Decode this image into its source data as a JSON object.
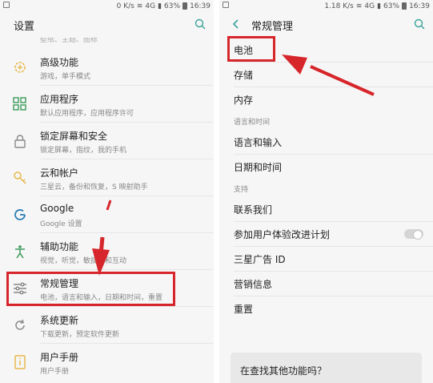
{
  "left": {
    "status": {
      "speed": "0 K/s",
      "signal": "4G",
      "battery": "63%",
      "time": "16:39"
    },
    "title": "设置",
    "cut_text": "壁纸、主题、图标",
    "items": [
      {
        "icon": "gear-plus-icon",
        "label": "高级功能",
        "sub": "游戏，单手模式"
      },
      {
        "icon": "apps-icon",
        "label": "应用程序",
        "sub": "默认应用程序，应用程序许可"
      },
      {
        "icon": "lock-icon",
        "label": "锁定屏幕和安全",
        "sub": "锁定屏幕，指纹，我的手机"
      },
      {
        "icon": "key-icon",
        "label": "云和帐户",
        "sub": "三星云，备份和恢复，S 映射助手"
      },
      {
        "icon": "google-icon",
        "label": "Google",
        "sub": "Google 设置"
      },
      {
        "icon": "accessibility-icon",
        "label": "辅助功能",
        "sub": "视觉，听觉，敏捷度和互动"
      },
      {
        "icon": "sliders-icon",
        "label": "常规管理",
        "sub": "电池，语言和输入，日期和时间，重置"
      },
      {
        "icon": "update-icon",
        "label": "系统更新",
        "sub": "下载更新，预定软件更新"
      },
      {
        "icon": "manual-icon",
        "label": "用户手册",
        "sub": "用户手册"
      }
    ]
  },
  "right": {
    "status": {
      "speed": "1.18 K/s",
      "signal": "4G",
      "battery": "63%",
      "time": "16:39"
    },
    "title": "常规管理",
    "items": {
      "battery": "电池",
      "storage": "存储",
      "memory": "内存",
      "section_language": "语言和时间",
      "language": "语言和输入",
      "datetime": "日期和时间",
      "section_support": "支持",
      "contact": "联系我们",
      "ux_program": "参加用户体验改进计划",
      "ad_id": "三星广告 ID",
      "marketing": "营销信息",
      "reset": "重置"
    },
    "card": "在查找其他功能吗？"
  },
  "colors": {
    "highlight": "#d7262b",
    "icon_yellow": "#e7b84a",
    "icon_blue": "#2b7fb6",
    "icon_green": "#3a9a5a"
  }
}
